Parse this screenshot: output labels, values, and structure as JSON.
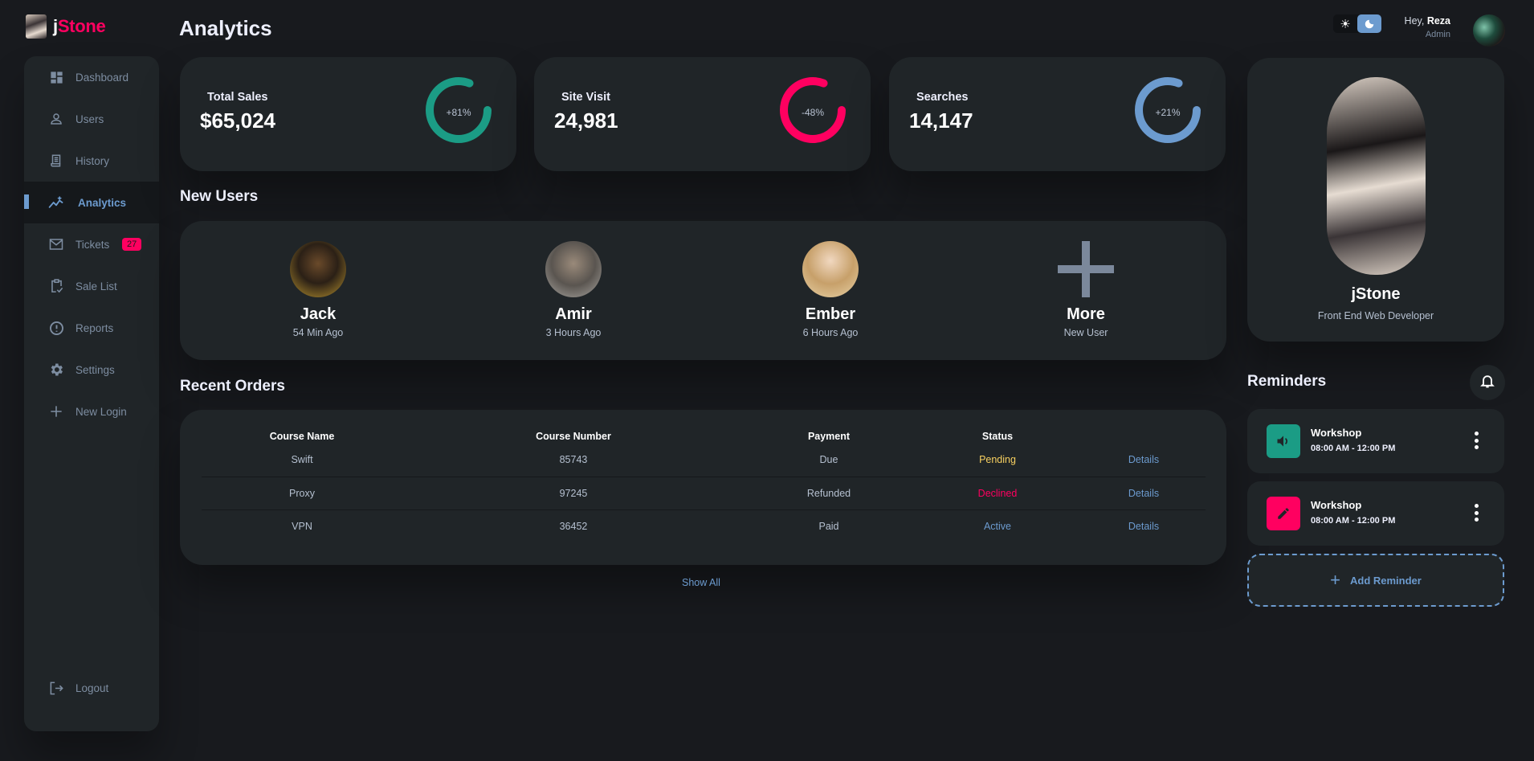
{
  "brand": {
    "prefix": "j",
    "rest": "Stone"
  },
  "sidebar": {
    "items": [
      {
        "label": "Dashboard",
        "icon": "dashboard-icon"
      },
      {
        "label": "Users",
        "icon": "person-icon"
      },
      {
        "label": "History",
        "icon": "receipt-icon"
      },
      {
        "label": "Analytics",
        "icon": "insights-icon",
        "active": true
      },
      {
        "label": "Tickets",
        "icon": "mail-icon",
        "badge": "27"
      },
      {
        "label": "Sale List",
        "icon": "clipboard-check-icon"
      },
      {
        "label": "Reports",
        "icon": "alert-circle-icon"
      },
      {
        "label": "Settings",
        "icon": "gear-icon"
      },
      {
        "label": "New Login",
        "icon": "plus-icon"
      }
    ],
    "logout": {
      "label": "Logout",
      "icon": "logout-icon"
    }
  },
  "header": {
    "title": "Analytics",
    "theme": {
      "light_icon": "sun-icon",
      "dark_icon": "moon-icon",
      "selected": "dark"
    },
    "greeting": "Hey,",
    "user_name": "Reza",
    "user_role": "Admin"
  },
  "stats": [
    {
      "label": "Total Sales",
      "value": "$65,024",
      "change": "+81%",
      "progress": 0.81,
      "color": "#1b9c85"
    },
    {
      "label": "Site Visit",
      "value": "24,981",
      "change": "-48%",
      "progress": 0.81,
      "color": "#ff0060"
    },
    {
      "label": "Searches",
      "value": "14,147",
      "change": "+21%",
      "progress": 0.81,
      "color": "#6c9bcf"
    }
  ],
  "new_users": {
    "title": "New Users",
    "users": [
      {
        "name": "Jack",
        "time": "54 Min Ago"
      },
      {
        "name": "Amir",
        "time": "3 Hours Ago"
      },
      {
        "name": "Ember",
        "time": "6 Hours Ago"
      },
      {
        "name": "More",
        "time": "New User"
      }
    ]
  },
  "orders": {
    "title": "Recent Orders",
    "columns": [
      "Course Name",
      "Course Number",
      "Payment",
      "Status",
      ""
    ],
    "rows": [
      {
        "name": "Swift",
        "number": "85743",
        "payment": "Due",
        "status": "Pending",
        "action": "Details"
      },
      {
        "name": "Proxy",
        "number": "97245",
        "payment": "Refunded",
        "status": "Declined",
        "action": "Details"
      },
      {
        "name": "VPN",
        "number": "36452",
        "payment": "Paid",
        "status": "Active",
        "action": "Details"
      }
    ],
    "show_all": "Show All"
  },
  "profile": {
    "name": "jStone",
    "role": "Front End Web Developer"
  },
  "reminders": {
    "title": "Reminders",
    "items": [
      {
        "title": "Workshop",
        "time": "08:00 AM - 12:00 PM",
        "icon": "volume-icon",
        "color": "#1b9c85"
      },
      {
        "title": "Workshop",
        "time": "08:00 AM - 12:00 PM",
        "icon": "edit-icon",
        "color": "#ff0060"
      }
    ],
    "add_label": "Add Reminder"
  }
}
